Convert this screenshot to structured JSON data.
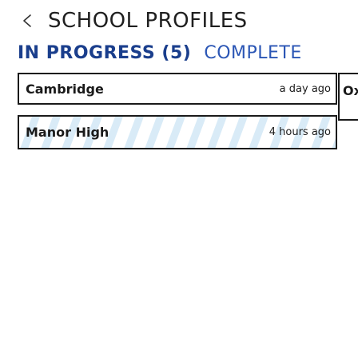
{
  "header": {
    "title": "SCHOOL PROFILES",
    "back_icon": "chevron-left-icon"
  },
  "tabs": {
    "in_progress": "IN PROGRESS (5)",
    "complete": "COMPLETE"
  },
  "colors": {
    "active_tab": "#1a3e8c",
    "inactive_tab": "#2b56b5",
    "stripe": "#d9ebf7",
    "border": "#1a1a1a"
  },
  "schools": [
    {
      "name": "Cambridge",
      "time": "a day ago",
      "striped": false
    },
    {
      "name": "Ox",
      "time": "",
      "striped": false
    },
    {
      "name": "Manor High",
      "time": "4 hours ago",
      "striped": true
    }
  ]
}
